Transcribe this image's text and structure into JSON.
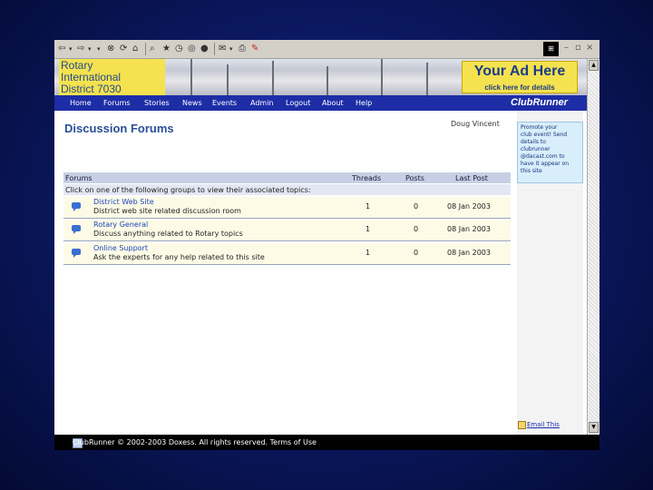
{
  "header": {
    "logo_lines": [
      "Rotary",
      "International",
      "District 7030"
    ],
    "ad_title": "Your Ad Here",
    "ad_subtitle": "click here for details",
    "brand": "ClubRunner"
  },
  "nav": [
    "Home",
    "Forums",
    "Stories",
    "News",
    "Events",
    "Admin",
    "Logout",
    "About",
    "Help"
  ],
  "page": {
    "title": "Discussion Forums",
    "user": "Doug Vincent"
  },
  "sidebar": {
    "promo_lines": [
      "Promote your",
      "club event! Send",
      "details to",
      "clubrunner",
      "@dacast.com to",
      "have it appear on",
      "this site"
    ],
    "email_link": "Email This"
  },
  "table": {
    "columns": [
      "Forums",
      "Threads",
      "Posts",
      "Last Post"
    ],
    "instruction": "Click on one of the following groups to view their associated topics:",
    "rows": [
      {
        "name": "District Web Site",
        "description": "District web site related discussion room",
        "threads": "1",
        "posts": "0",
        "last_post": "08 Jan 2003"
      },
      {
        "name": "Rotary General",
        "description": "Discuss anything related to Rotary topics",
        "threads": "1",
        "posts": "0",
        "last_post": "08 Jan 2003"
      },
      {
        "name": "Online Support",
        "description": "Ask the experts for any help related to this site",
        "threads": "1",
        "posts": "0",
        "last_post": "08 Jan 2003"
      }
    ]
  },
  "footer": {
    "text": "ClubRunner © 2002-2003 Doxess. All rights reserved. Terms of Use"
  },
  "colors": {
    "nav_bg": "#1d2da6",
    "title": "#2a4f94",
    "logo_bg": "#f4e24f",
    "row_bg": "#fdfbe6",
    "link": "#1d44c0"
  },
  "icons": [
    "back-icon",
    "forward-icon",
    "stop-icon",
    "refresh-icon",
    "home-icon",
    "search-icon",
    "favorites-icon",
    "history-icon",
    "mail-icon",
    "print-icon",
    "edit-icon",
    "windows-logo-icon",
    "forum-icon",
    "email-icon"
  ]
}
